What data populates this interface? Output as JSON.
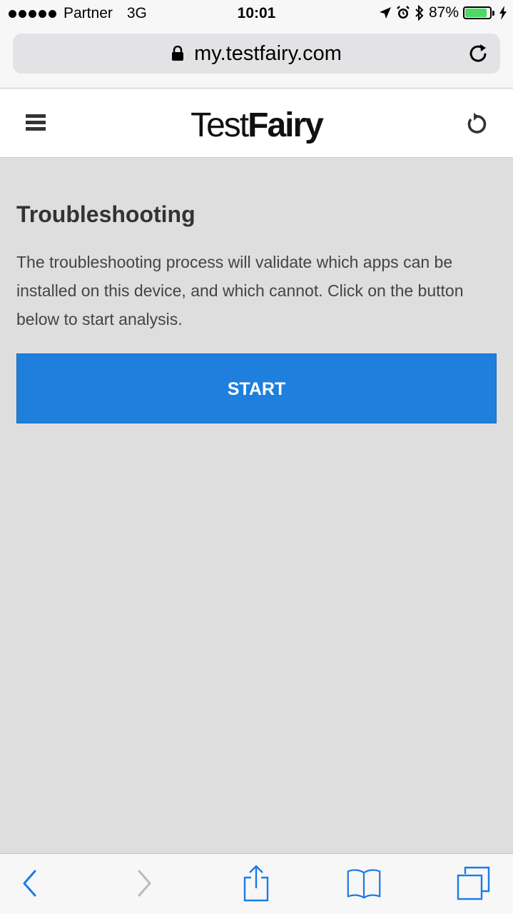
{
  "status_bar": {
    "carrier": "Partner",
    "network": "3G",
    "time": "10:01",
    "battery_percent": "87%",
    "battery_level": 0.87,
    "battery_color": "#4cd964",
    "icons": [
      "signal-dots",
      "location-arrow-icon",
      "alarm-icon",
      "bluetooth-icon",
      "battery-icon",
      "charging-bolt-icon"
    ]
  },
  "browser": {
    "url": "my.testfairy.com",
    "icons": [
      "lock-icon",
      "reload-icon"
    ]
  },
  "site_header": {
    "logo_light": "Test",
    "logo_bold": "Fairy",
    "icons": [
      "hamburger-menu-icon",
      "refresh-icon"
    ]
  },
  "main": {
    "title": "Troubleshooting",
    "description": "The troubleshooting process will validate which apps can be installed on this device, and which cannot. Click on the button below to start analysis.",
    "start_button_label": "START",
    "button_color": "#1f7fdc",
    "background_color": "#dedede"
  },
  "toolbar": {
    "icons": [
      "back-icon",
      "forward-icon",
      "share-icon",
      "bookmarks-icon",
      "tabs-icon"
    ],
    "accent_color": "#1a7be8"
  }
}
